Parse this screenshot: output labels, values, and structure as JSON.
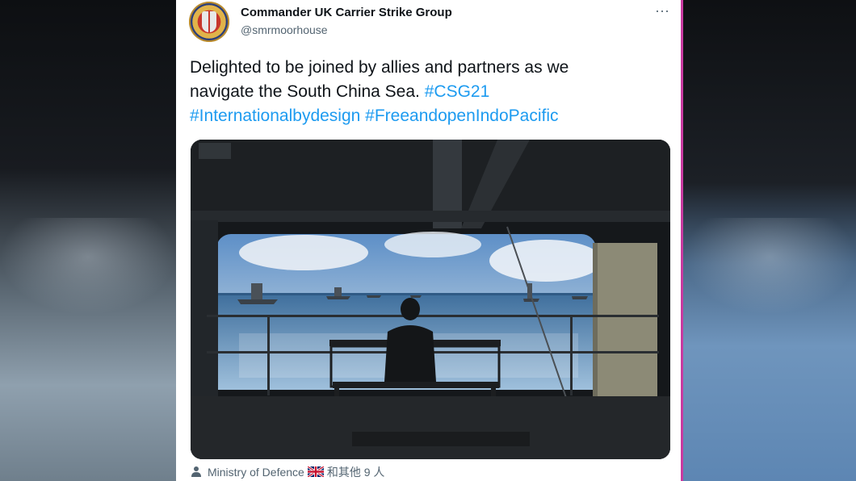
{
  "tweet": {
    "display_name": "Commander UK Carrier Strike Group",
    "handle": "@smrmoorhouse",
    "more_label": "···",
    "text_plain_1": "Delighted to be joined by allies and partners as we",
    "text_plain_2": "navigate the South China Sea. ",
    "hashtags": [
      "#CSG21",
      "#Internationalbydesign",
      "#FreeandopenIndoPacific"
    ],
    "tagged_primary": "Ministry of Defence",
    "tagged_others": "和其他 9 人",
    "icons": {
      "avatar": "crest-avatar",
      "more": "more-horizontal-icon",
      "person": "person-icon",
      "flag": "uk-flag-icon"
    }
  },
  "colors": {
    "link": "#1d9bf0",
    "text": "#0f1419",
    "secondary": "#536471"
  }
}
